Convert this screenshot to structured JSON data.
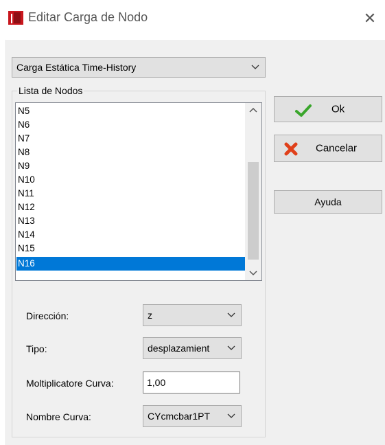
{
  "window": {
    "title": "Editar Carga de Nodo",
    "close_glyph": "✕",
    "icon": "app-icon"
  },
  "load_type": {
    "selected": "Carga Estática Time-History"
  },
  "node_list": {
    "group_label": "Lista de Nodos",
    "items": [
      "N5",
      "N6",
      "N7",
      "N8",
      "N9",
      "N10",
      "N11",
      "N12",
      "N13",
      "N14",
      "N15",
      "N16"
    ],
    "selected": "N16"
  },
  "buttons": {
    "ok": "Ok",
    "cancel": "Cancelar",
    "help": "Ayuda"
  },
  "fields": {
    "direction": {
      "label": "Dirección:",
      "value": "z"
    },
    "type": {
      "label": "Tipo:",
      "value": "desplazamient"
    },
    "multiplier": {
      "label": "Moltiplicatore Curva:",
      "value": "1,00"
    },
    "curve_name": {
      "label": "Nombre Curva:",
      "value": "CYcmcbar1PT"
    }
  },
  "colors": {
    "selection": "#0078d7",
    "ok_check": "#3aa62c",
    "cancel_x": "#e0401a",
    "app_icon": "#c8161d"
  }
}
